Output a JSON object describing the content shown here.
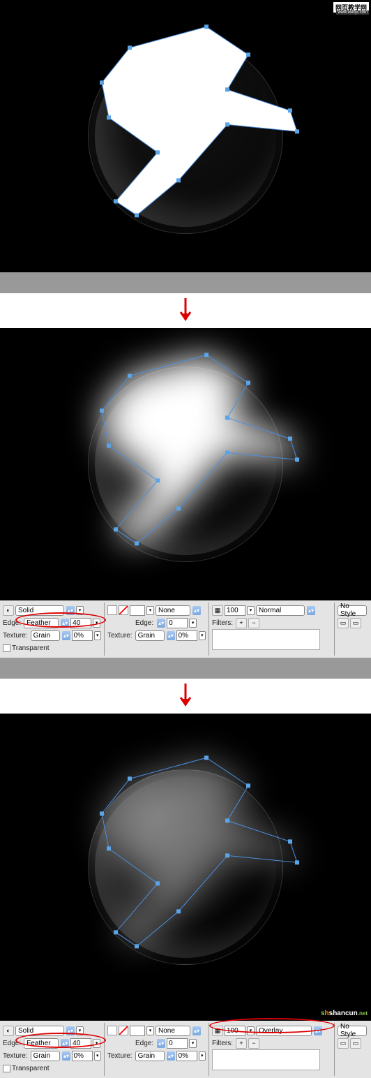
{
  "watermark": {
    "main": "网页教学网",
    "sub": "www.webjx.com"
  },
  "shancun": {
    "text": "shancun",
    "domain": ".net"
  },
  "panel1": {
    "fill_type": "Solid",
    "edge_label": "Edge:",
    "edge_type": "Feather",
    "edge_value": "40",
    "texture_label": "Texture:",
    "texture_type": "Grain",
    "texture_value": "0%",
    "transparent_label": "Transparent",
    "stroke_type": "None",
    "stroke_edge_label": "Edge:",
    "stroke_edge_value": "0",
    "stroke_texture_label": "Texture:",
    "stroke_texture_type": "Grain",
    "stroke_texture_value": "0%",
    "opacity": "100",
    "blend_mode": "Normal",
    "filters_label": "Filters:",
    "style_label": "No Style"
  },
  "panel2": {
    "fill_type": "Solid",
    "edge_label": "Edge:",
    "edge_type": "Feather",
    "edge_value": "40",
    "texture_label": "Texture:",
    "texture_type": "Grain",
    "texture_value": "0%",
    "transparent_label": "Transparent",
    "stroke_type": "None",
    "stroke_edge_label": "Edge:",
    "stroke_edge_value": "0",
    "stroke_texture_label": "Texture:",
    "stroke_texture_type": "Grain",
    "stroke_texture_value": "0%",
    "opacity": "100",
    "blend_mode": "Overlay",
    "filters_label": "Filters:",
    "style_label": "No Style"
  }
}
